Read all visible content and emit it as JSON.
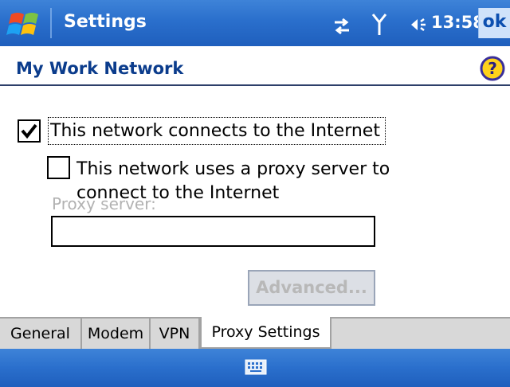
{
  "titlebar": {
    "title": "Settings",
    "clock": "13:58",
    "ok_label": "ok",
    "icons": [
      "windows-start-icon",
      "connectivity-icon",
      "signal-icon",
      "volume-icon"
    ]
  },
  "page": {
    "title": "My Work Network",
    "help_icon": "help-icon"
  },
  "options": {
    "internet_checkbox": {
      "label": "This network connects to the Internet",
      "checked": true
    },
    "proxy_checkbox": {
      "label": "This network uses a proxy server to connect to the Internet",
      "checked": false
    }
  },
  "proxy": {
    "label": "Proxy server:",
    "value": ""
  },
  "advanced_label": "Advanced...",
  "tabs": [
    {
      "label": "General",
      "active": false
    },
    {
      "label": "Modem",
      "active": false
    },
    {
      "label": "VPN",
      "active": false
    },
    {
      "label": "Proxy Settings",
      "active": true
    }
  ],
  "bottombar": {
    "icon": "keyboard-icon"
  },
  "colors": {
    "titlebar": "#2a6fcc",
    "heading": "#0b3c8c",
    "disabled_text": "#b2b2b2",
    "tab_bg": "#d8d8d8"
  }
}
